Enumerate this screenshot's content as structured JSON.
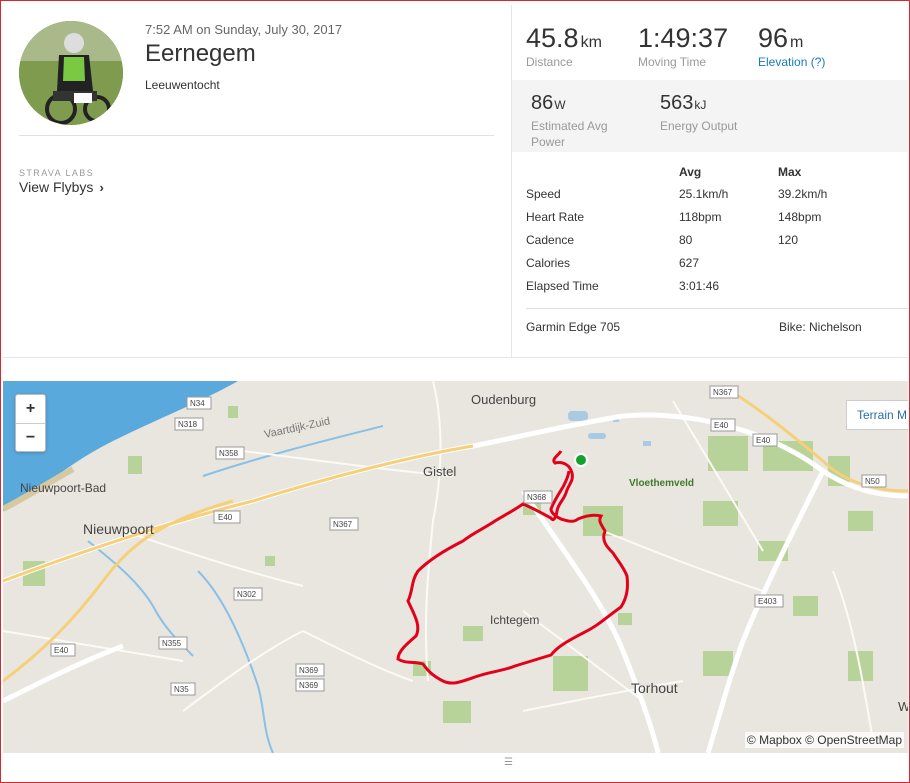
{
  "activity": {
    "datetime": "7:52 AM on Sunday, July 30, 2017",
    "title": "Eernegem",
    "description": "Leeuwentocht",
    "labs_label": "STRAVA LABS",
    "flyby_label": "View Flybys"
  },
  "stats": {
    "distance": {
      "value": "45.8",
      "unit": "km",
      "label": "Distance"
    },
    "moving_time": {
      "value": "1:49:37",
      "label": "Moving Time"
    },
    "elevation": {
      "value": "96",
      "unit": "m",
      "label": "Elevation (?)"
    },
    "power": {
      "value": "86",
      "unit": "W",
      "label_line1": "Estimated Avg",
      "label_line2": "Power"
    },
    "energy": {
      "value": "563",
      "unit": "kJ",
      "label": "Energy Output"
    }
  },
  "metrics": {
    "headers": [
      "",
      "Avg",
      "Max"
    ],
    "rows": [
      {
        "name": "Speed",
        "avg": "25.1km/h",
        "max": "39.2km/h"
      },
      {
        "name": "Heart Rate",
        "avg": "118bpm",
        "max": "148bpm"
      },
      {
        "name": "Cadence",
        "avg": "80",
        "max": "120"
      },
      {
        "name": "Calories",
        "avg": "627",
        "max": ""
      },
      {
        "name": "Elapsed Time",
        "avg": "3:01:46",
        "max": ""
      }
    ]
  },
  "device": "Garmin Edge 705",
  "bike": "Bike: Nichelson",
  "map": {
    "zoom_in": "+",
    "zoom_out": "−",
    "terrain_label": "Terrain M",
    "attribution": "© Mapbox © OpenStreetMap",
    "route_color": "#e3001b",
    "place_labels": {
      "oudenburg": "Oudenburg",
      "gistel": "Gistel",
      "nieuwpoort_bad": "Nieuwpoort-Bad",
      "nieuwpoort": "Nieuwpoort",
      "ichtegem": "Ichtegem",
      "torhout": "Torhout",
      "vloethemveld": "Vloethemveld",
      "vaartdijk": "Vaartdijk-Zuid",
      "w": "W"
    },
    "road_labels": [
      "N34",
      "N318",
      "N358",
      "E40",
      "N367",
      "N368",
      "N302",
      "N355",
      "N35",
      "N369",
      "N369",
      "E40",
      "N367",
      "E40",
      "E40",
      "N50",
      "E403"
    ]
  }
}
